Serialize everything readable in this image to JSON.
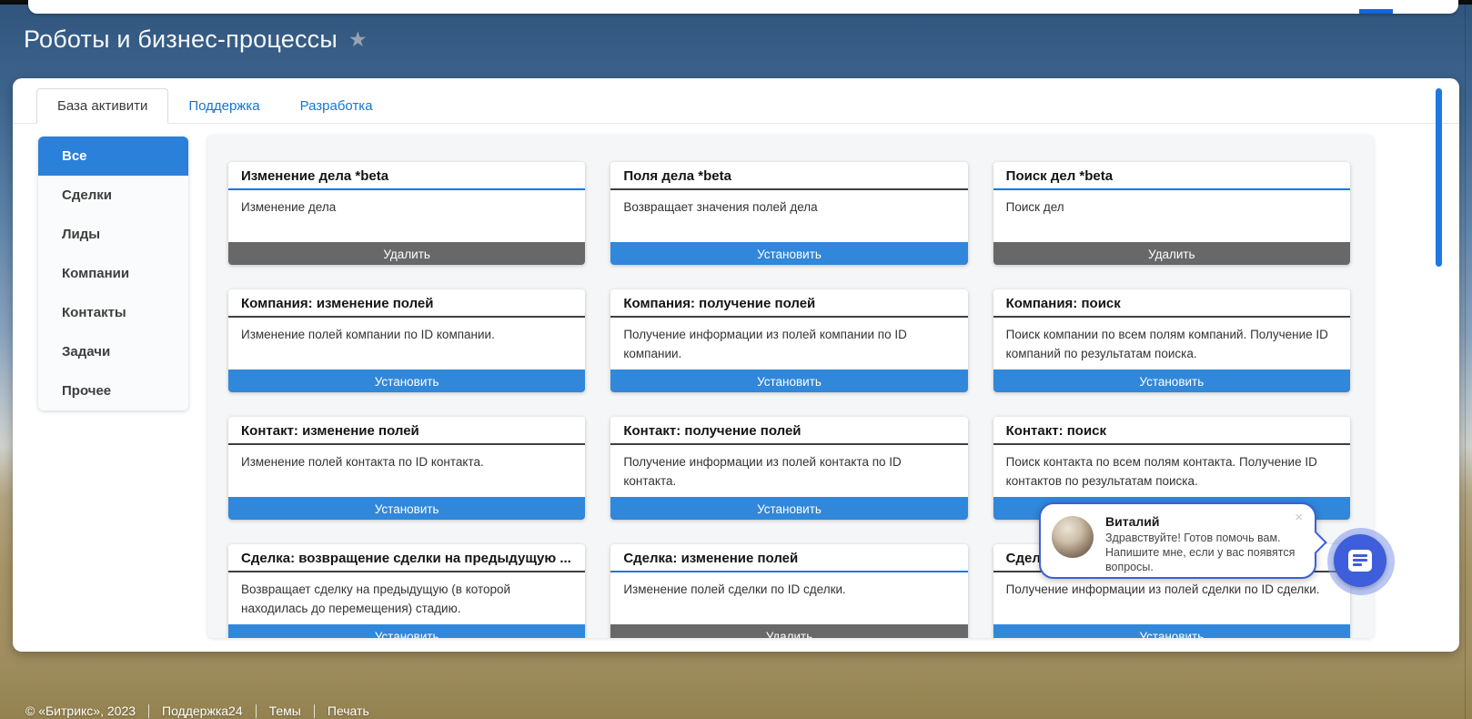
{
  "page": {
    "title": "Роботы и бизнес-процессы",
    "favorite_icon": "★"
  },
  "tabs": [
    {
      "label": "База активити",
      "active": true
    },
    {
      "label": "Поддержка",
      "active": false
    },
    {
      "label": "Разработка",
      "active": false
    }
  ],
  "sidebar": {
    "items": [
      {
        "label": "Все",
        "active": true
      },
      {
        "label": "Сделки",
        "active": false
      },
      {
        "label": "Лиды",
        "active": false
      },
      {
        "label": "Компании",
        "active": false
      },
      {
        "label": "Контакты",
        "active": false
      },
      {
        "label": "Задачи",
        "active": false
      },
      {
        "label": "Прочее",
        "active": false
      }
    ]
  },
  "cards": [
    {
      "title": "Изменение дела *beta",
      "description": "Изменение дела",
      "separator": "blue",
      "button_label": "Удалить",
      "button_variant": "gray"
    },
    {
      "title": "Поля дела *beta",
      "description": "Возвращает значения полей дела",
      "separator": "dark",
      "button_label": "Установить",
      "button_variant": "blue"
    },
    {
      "title": "Поиск дел *beta",
      "description": "Поиск дел",
      "separator": "blue",
      "button_label": "Удалить",
      "button_variant": "gray"
    },
    {
      "title": "Компания: изменение полей",
      "description": "Изменение полей компании по ID компании.",
      "separator": "dark",
      "button_label": "Установить",
      "button_variant": "blue"
    },
    {
      "title": "Компания: получение полей",
      "description": "Получение информации из полей компании по ID компании.",
      "separator": "dark",
      "button_label": "Установить",
      "button_variant": "blue"
    },
    {
      "title": "Компания: поиск",
      "description": "Поиск компании по всем полям компаний. Получение ID компаний по результатам поиска.",
      "separator": "dark",
      "button_label": "Установить",
      "button_variant": "blue"
    },
    {
      "title": "Контакт: изменение полей",
      "description": "Изменение полей контакта по ID контакта.",
      "separator": "dark",
      "button_label": "Установить",
      "button_variant": "blue"
    },
    {
      "title": "Контакт: получение полей",
      "description": "Получение информации из полей контакта по ID контакта.",
      "separator": "dark",
      "button_label": "Установить",
      "button_variant": "blue"
    },
    {
      "title": "Контакт: поиск",
      "description": "Поиск контакта по всем полям контакта. Получение ID контактов по результатам поиска.",
      "separator": "dark",
      "button_label": "Установить",
      "button_variant": "blue"
    },
    {
      "title": "Сделка: возвращение сделки на предыдущую ...",
      "description": "Возвращает сделку на предыдущую (в которой находилась до перемещения) стадию.",
      "separator": "dark",
      "button_label": "Установить",
      "button_variant": "blue"
    },
    {
      "title": "Сделка: изменение полей",
      "description": "Изменение полей сделки по ID сделки.",
      "separator": "blue",
      "button_label": "Удалить",
      "button_variant": "gray"
    },
    {
      "title": "Сделка: получение полей",
      "description": "Получение информации из полей сделки по ID сделки.",
      "separator": "dark",
      "button_label": "Установить",
      "button_variant": "blue"
    }
  ],
  "chat": {
    "name": "Виталий",
    "message": "Здравствуйте! Готов помочь вам. Напишите мне, если у вас появятся вопросы.",
    "close_icon": "×",
    "icon": "chat-lines-icon"
  },
  "footer": {
    "copyright": "© «Битрикс», 2023",
    "links": [
      "Поддержка24",
      "Темы",
      "Печать"
    ]
  },
  "colors": {
    "accent_blue": "#3187d9",
    "link_blue": "#1377d0",
    "sidebar_selected_blue": "#2b80d9",
    "button_gray": "#686868",
    "separator_blue": "#1778e0",
    "separator_dark": "#3f3f3f",
    "chat_blue": "#3e5edb",
    "scrollbar_blue": "#1c79e2",
    "top_indicator_blue": "#1565d8"
  }
}
